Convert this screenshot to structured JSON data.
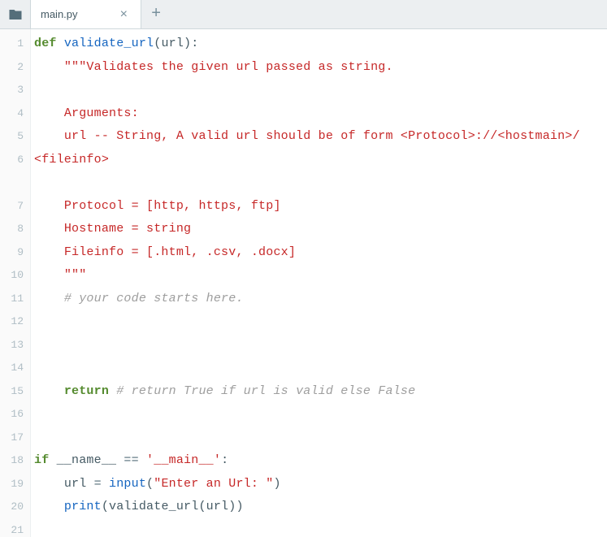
{
  "tab": {
    "title": "main.py",
    "close_label": "×",
    "add_label": "+"
  },
  "gutter": {
    "lines": [
      "1",
      "2",
      "3",
      "4",
      "5",
      "6",
      "7",
      "8",
      "9",
      "10",
      "11",
      "12",
      "13",
      "14",
      "15",
      "16",
      "17",
      "18",
      "19",
      "20",
      "21"
    ]
  },
  "code": {
    "l1": {
      "def": "def",
      "name": "validate_url",
      "open": "(",
      "arg": "url",
      "close": "):"
    },
    "l2": {
      "indent": "    ",
      "str": "\"\"\"Validates the given url passed as string."
    },
    "l3": {
      "text": ""
    },
    "l4": {
      "indent": "    ",
      "str": "Arguments:"
    },
    "l5": {
      "indent": "    ",
      "str": "url -- String, A valid url should be of form <Protocol>://<hostmain>/"
    },
    "l5w": {
      "str": "<fileinfo>"
    },
    "l6": {
      "text": ""
    },
    "l7": {
      "indent": "    ",
      "str": "Protocol = [http, https, ftp]"
    },
    "l8": {
      "indent": "    ",
      "str": "Hostname = string"
    },
    "l9": {
      "indent": "    ",
      "str": "Fileinfo = [.html, .csv, .docx]"
    },
    "l10": {
      "indent": "    ",
      "str": "\"\"\""
    },
    "l11": {
      "indent": "    ",
      "comment": "# your code starts here."
    },
    "l12": {
      "text": ""
    },
    "l13": {
      "text": ""
    },
    "l14": {
      "text": ""
    },
    "l15": {
      "indent": "    ",
      "kw": "return",
      "sp": " ",
      "comment": "# return True if url is valid else False"
    },
    "l16": {
      "text": ""
    },
    "l17": {
      "text": ""
    },
    "l18": {
      "kw": "if",
      "sp": " ",
      "var": "__name__",
      "op": " == ",
      "str": "'__main__'",
      "colon": ":"
    },
    "l19": {
      "indent": "    ",
      "var": "url",
      "op": " = ",
      "fn": "input",
      "open": "(",
      "str": "\"Enter an Url: \"",
      "close": ")"
    },
    "l20": {
      "indent": "    ",
      "fn": "print",
      "open": "(",
      "call": "validate_url",
      "argopen": "(",
      "arg": "url",
      "argclose": ")",
      "close": ")"
    },
    "l21": {
      "text": ""
    }
  }
}
